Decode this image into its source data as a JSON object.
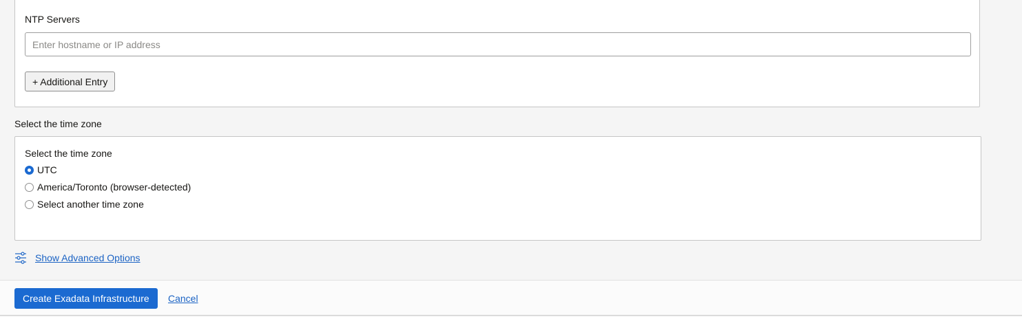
{
  "ntp": {
    "label": "NTP Servers",
    "input_value": "",
    "input_placeholder": "Enter hostname or IP address",
    "add_entry_label": "+ Additional Entry"
  },
  "timezone": {
    "section_title": "Select the time zone",
    "group_label": "Select the time zone",
    "options": [
      {
        "label": "UTC",
        "selected": true
      },
      {
        "label": "America/Toronto (browser-detected)",
        "selected": false
      },
      {
        "label": "Select another time zone",
        "selected": false
      }
    ]
  },
  "advanced": {
    "icon": "sliders-icon",
    "link_label": "Show Advanced Options"
  },
  "footer": {
    "create_label": "Create Exadata Infrastructure",
    "cancel_label": "Cancel"
  },
  "colors": {
    "accent": "#1b6ad1",
    "link": "#1b63c4"
  }
}
